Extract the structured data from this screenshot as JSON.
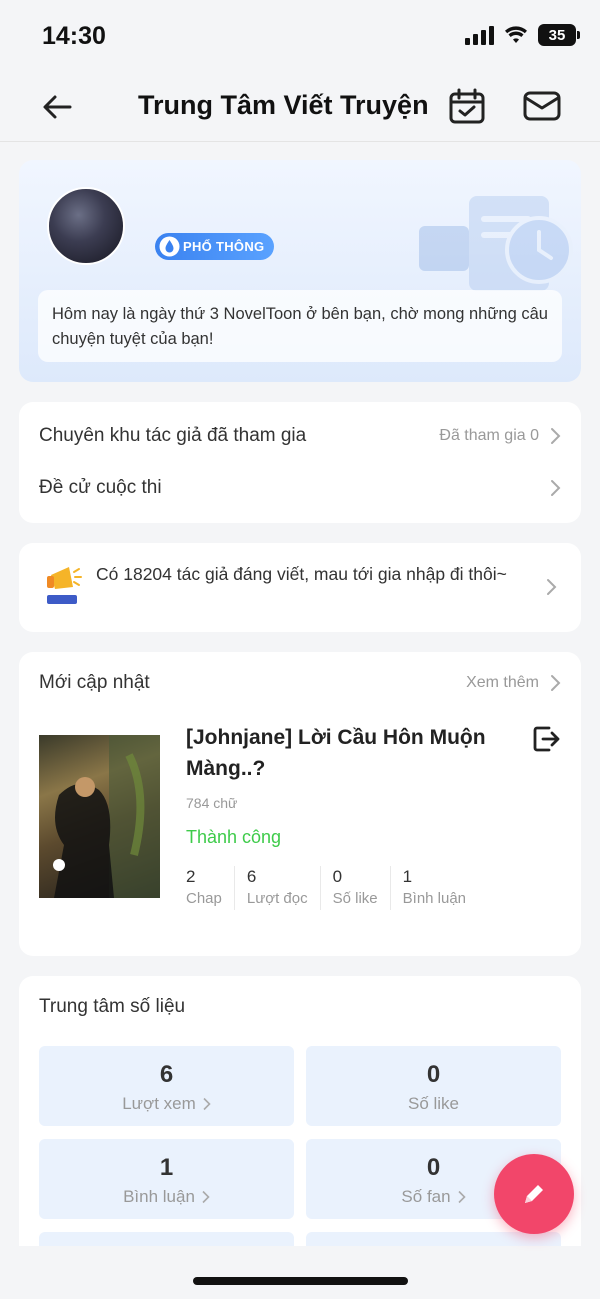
{
  "status_bar": {
    "time": "14:30",
    "battery": "35"
  },
  "header": {
    "title": "Trung Tâm Viết Truyện"
  },
  "profile": {
    "badge": "PHỔ THÔNG",
    "greeting": "Hôm nay là ngày thứ 3 NovelToon ở bên bạn, chờ mong những câu chuyện tuyệt của bạn!"
  },
  "links": [
    {
      "label": "Chuyên khu tác giả đã tham gia",
      "value": "Đã tham gia 0"
    },
    {
      "label": "Đề cử cuộc thi",
      "value": ""
    }
  ],
  "promo": {
    "text": "Có 18204 tác giả đáng viết, mau tới gia nhập đi thôi~"
  },
  "updates": {
    "title": "Mới cập nhật",
    "more": "Xem thêm",
    "book": {
      "title": "[Johnjane] Lời Cầu Hôn Muộn Màng..?",
      "words": "784 chữ",
      "status": "Thành công",
      "stats": [
        {
          "value": "2",
          "label": "Chap"
        },
        {
          "value": "6",
          "label": "Lượt đọc"
        },
        {
          "value": "0",
          "label": "Số like"
        },
        {
          "value": "1",
          "label": "Bình luận"
        }
      ]
    }
  },
  "metrics": {
    "title": "Trung tâm số liệu",
    "tiles": [
      {
        "value": "6",
        "label": "Lượt xem"
      },
      {
        "value": "0",
        "label": "Số like"
      },
      {
        "value": "1",
        "label": "Bình luận"
      },
      {
        "value": "0",
        "label": "Số fan"
      }
    ]
  },
  "colors": {
    "accent": "#f2466a",
    "success": "#3ecb4a",
    "badge": "#3a82f0",
    "tile": "#eaf2fd"
  },
  "icons": [
    "back-arrow-icon",
    "calendar-check-icon",
    "mail-icon",
    "droplet-badge-icon",
    "chevron-right-icon",
    "megaphone-icon",
    "exit-icon",
    "pencil-icon"
  ]
}
